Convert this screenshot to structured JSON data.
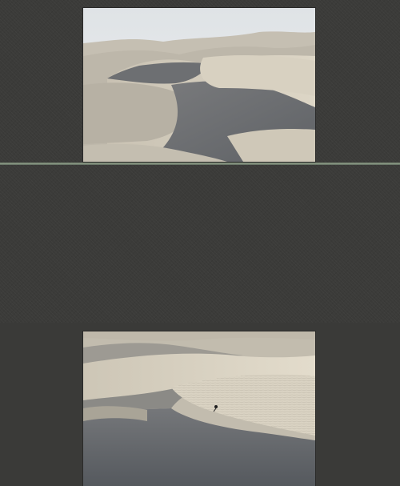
{
  "toolbar": {
    "icons": [
      {
        "name": "folder-icon",
        "color": "#e7c95a"
      },
      {
        "name": "star-icon",
        "color": "#f3d23c"
      },
      {
        "name": "page-icon",
        "color": "#e9e9e6"
      },
      {
        "name": "copy-icon",
        "color": "#d5d5d2"
      },
      {
        "name": "settings-icon",
        "color": "#b7b7b3"
      },
      {
        "name": "tag-icon",
        "color": "#e0a84a"
      },
      {
        "name": "globe-icon",
        "color": "#5fae6a"
      },
      {
        "name": "arrow-icon",
        "color": "#9a9a96"
      },
      {
        "name": "close-icon",
        "color": "#d9d9d6"
      }
    ]
  },
  "panes": {
    "top": {
      "image": "sand-dunes-wide"
    },
    "bottom": {
      "image": "sand-dunes-closeup"
    }
  },
  "colors": {
    "background": "#3b3b39",
    "divider": "#7f8c79",
    "sky": "#e2e6e8",
    "sand_light": "#d6cfbf",
    "sand_shadow": "#6f7071"
  }
}
